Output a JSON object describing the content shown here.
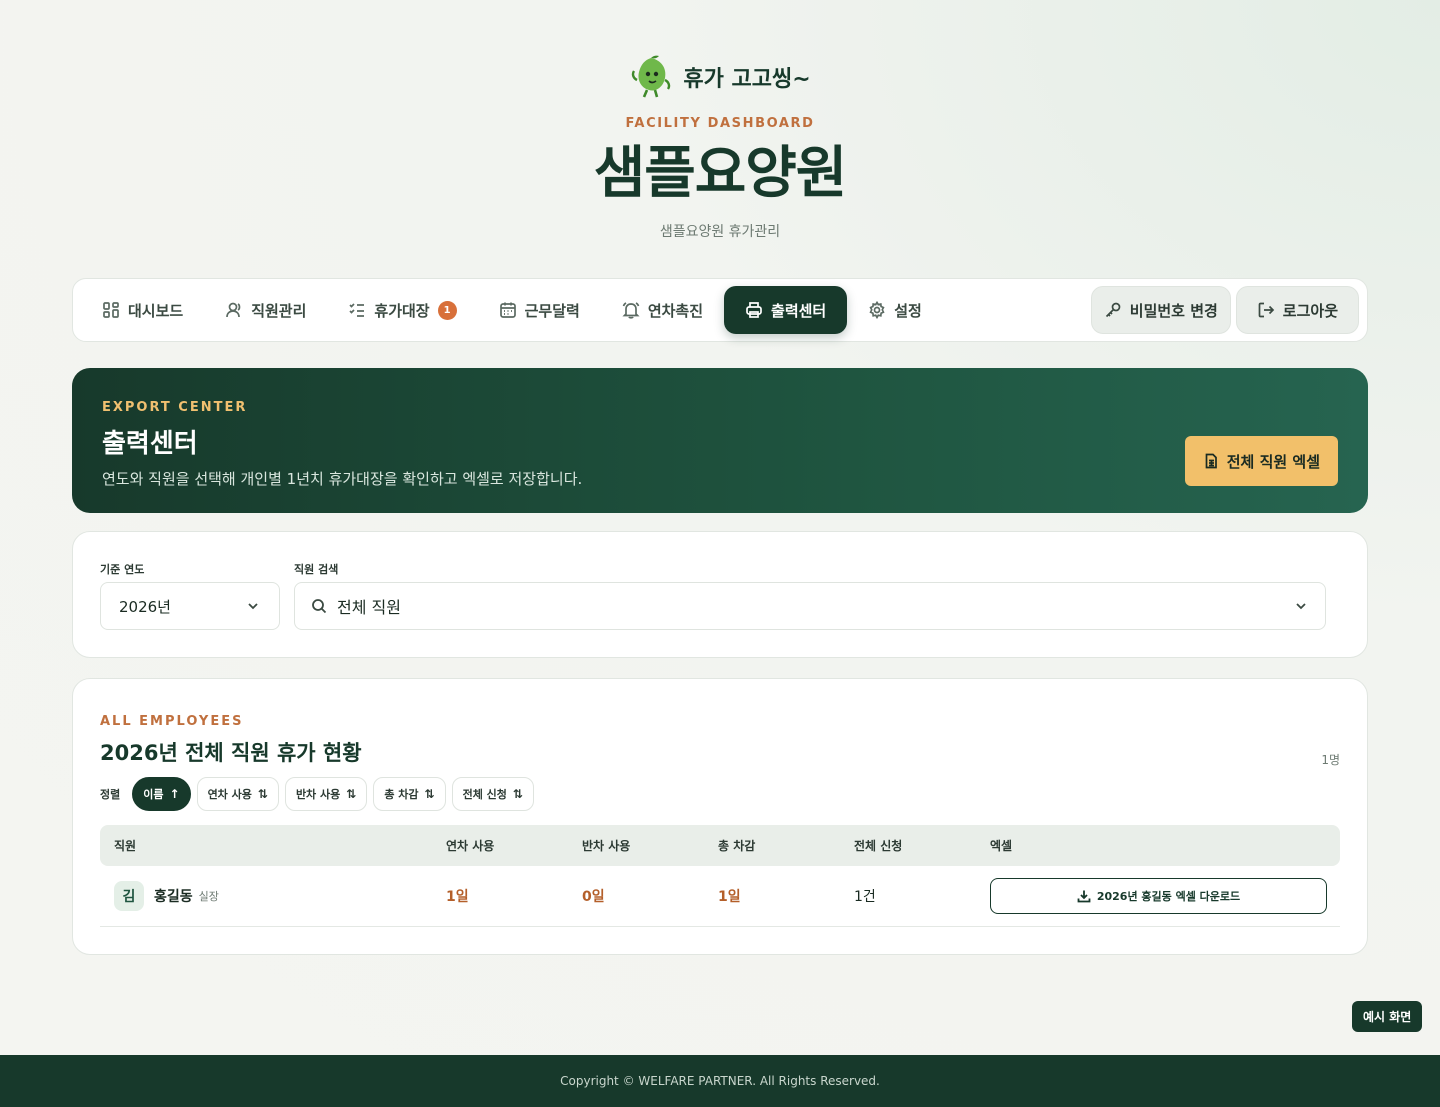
{
  "brand": {
    "name": "휴가 고고씽~",
    "logo_icon": "leaf-mascot-icon"
  },
  "header": {
    "eyebrow": "FACILITY DASHBOARD",
    "facility_name": "샘플요양원",
    "subtitle": "샘플요양원 휴가관리"
  },
  "nav": {
    "items": [
      {
        "label": "대시보드",
        "icon": "grid-icon",
        "active": false
      },
      {
        "label": "직원관리",
        "icon": "user-icon",
        "active": false
      },
      {
        "label": "휴가대장",
        "icon": "checklist-icon",
        "badge": "1",
        "active": false
      },
      {
        "label": "근무달력",
        "icon": "calendar-icon",
        "active": false
      },
      {
        "label": "연차촉진",
        "icon": "bell-icon",
        "active": false
      },
      {
        "label": "출력센터",
        "icon": "printer-icon",
        "active": true
      },
      {
        "label": "설정",
        "icon": "gear-icon",
        "active": false
      }
    ],
    "password_button": "비밀번호 변경",
    "logout_button": "로그아웃"
  },
  "hero": {
    "eyebrow": "EXPORT CENTER",
    "title": "출력센터",
    "description": "연도와 직원을 선택해 개인별 1년치 휴가대장을 확인하고 엑셀로 저장합니다.",
    "export_all_button": "전체 직원 엑셀"
  },
  "filters": {
    "year_label": "기준 연도",
    "year_value": "2026년",
    "search_label": "직원 검색",
    "search_value": "전체 직원"
  },
  "list": {
    "eyebrow": "ALL EMPLOYEES",
    "title": "2026년 전체 직원 휴가 현황",
    "count": "1명",
    "sort_label": "정렬",
    "sort_options": [
      {
        "label": "이름",
        "arrow": "↑",
        "active": true
      },
      {
        "label": "연차 사용",
        "arrow": "⇅",
        "active": false
      },
      {
        "label": "반차 사용",
        "arrow": "⇅",
        "active": false
      },
      {
        "label": "총 차감",
        "arrow": "⇅",
        "active": false
      },
      {
        "label": "전체 신청",
        "arrow": "⇅",
        "active": false
      }
    ],
    "columns": [
      "직원",
      "연차 사용",
      "반차 사용",
      "총 차감",
      "전체 신청",
      "엑셀"
    ],
    "rows": [
      {
        "avatar": "김",
        "name": "홍길동",
        "role": "실장",
        "annual_used": "1일",
        "half_used": "0일",
        "total_deducted": "1일",
        "total_requests": "1건",
        "download_label": "2026년 홍길동 엑셀 다운로드"
      }
    ]
  },
  "demo_badge": "예시 화면",
  "footer": {
    "copyright": "Copyright © WELFARE PARTNER. All Rights Reserved."
  },
  "colors": {
    "primary": "#17392b",
    "accent": "#c0703e",
    "gold": "#f2c06a",
    "badge": "#d8703a"
  }
}
